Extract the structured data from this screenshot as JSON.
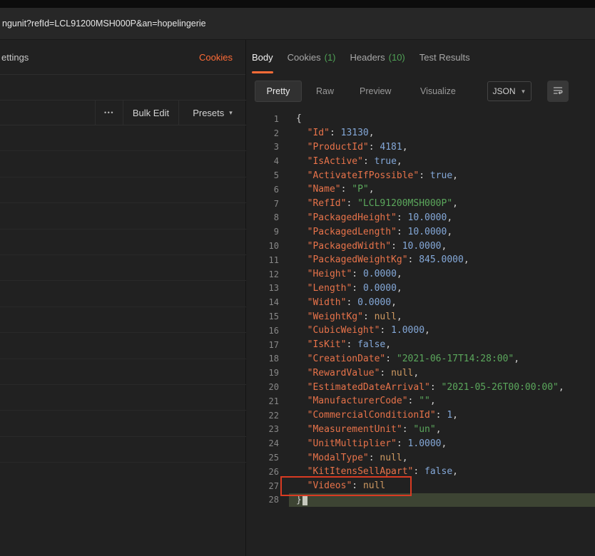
{
  "topbar": {
    "url": "ngunit?refId=LCL91200MSH000P&an=hopelingerie"
  },
  "request_panel": {
    "settings_tab": "ettings",
    "cookies_link": "Cookies",
    "more_button": "•••",
    "bulk_edit": "Bulk Edit",
    "presets": "Presets",
    "row_count": 13
  },
  "response": {
    "tabs": [
      {
        "label": "Body",
        "active": true
      },
      {
        "label": "Cookies",
        "count": "(1)"
      },
      {
        "label": "Headers",
        "count": "(10)"
      },
      {
        "label": "Test Results"
      }
    ],
    "view_modes": [
      "Pretty",
      "Raw",
      "Preview",
      "Visualize"
    ],
    "active_mode": "Pretty",
    "format": "JSON",
    "code_lines": [
      {
        "n": 1,
        "t": [
          [
            "pt",
            "{"
          ]
        ]
      },
      {
        "n": 2,
        "t": [
          [
            "pt",
            "  "
          ],
          [
            "key",
            "\"Id\""
          ],
          [
            "pt",
            ": "
          ],
          [
            "num",
            "13130"
          ],
          [
            "pt",
            ","
          ]
        ]
      },
      {
        "n": 3,
        "t": [
          [
            "pt",
            "  "
          ],
          [
            "key",
            "\"ProductId\""
          ],
          [
            "pt",
            ": "
          ],
          [
            "num",
            "4181"
          ],
          [
            "pt",
            ","
          ]
        ]
      },
      {
        "n": 4,
        "t": [
          [
            "pt",
            "  "
          ],
          [
            "key",
            "\"IsActive\""
          ],
          [
            "pt",
            ": "
          ],
          [
            "bool",
            "true"
          ],
          [
            "pt",
            ","
          ]
        ]
      },
      {
        "n": 5,
        "t": [
          [
            "pt",
            "  "
          ],
          [
            "key",
            "\"ActivateIfPossible\""
          ],
          [
            "pt",
            ": "
          ],
          [
            "bool",
            "true"
          ],
          [
            "pt",
            ","
          ]
        ]
      },
      {
        "n": 6,
        "t": [
          [
            "pt",
            "  "
          ],
          [
            "key",
            "\"Name\""
          ],
          [
            "pt",
            ": "
          ],
          [
            "str",
            "\"P\""
          ],
          [
            "pt",
            ","
          ]
        ]
      },
      {
        "n": 7,
        "t": [
          [
            "pt",
            "  "
          ],
          [
            "key",
            "\"RefId\""
          ],
          [
            "pt",
            ": "
          ],
          [
            "str",
            "\"LCL91200MSH000P\""
          ],
          [
            "pt",
            ","
          ]
        ]
      },
      {
        "n": 8,
        "t": [
          [
            "pt",
            "  "
          ],
          [
            "key",
            "\"PackagedHeight\""
          ],
          [
            "pt",
            ": "
          ],
          [
            "num",
            "10.0000"
          ],
          [
            "pt",
            ","
          ]
        ]
      },
      {
        "n": 9,
        "t": [
          [
            "pt",
            "  "
          ],
          [
            "key",
            "\"PackagedLength\""
          ],
          [
            "pt",
            ": "
          ],
          [
            "num",
            "10.0000"
          ],
          [
            "pt",
            ","
          ]
        ]
      },
      {
        "n": 10,
        "t": [
          [
            "pt",
            "  "
          ],
          [
            "key",
            "\"PackagedWidth\""
          ],
          [
            "pt",
            ": "
          ],
          [
            "num",
            "10.0000"
          ],
          [
            "pt",
            ","
          ]
        ]
      },
      {
        "n": 11,
        "t": [
          [
            "pt",
            "  "
          ],
          [
            "key",
            "\"PackagedWeightKg\""
          ],
          [
            "pt",
            ": "
          ],
          [
            "num",
            "845.0000"
          ],
          [
            "pt",
            ","
          ]
        ]
      },
      {
        "n": 12,
        "t": [
          [
            "pt",
            "  "
          ],
          [
            "key",
            "\"Height\""
          ],
          [
            "pt",
            ": "
          ],
          [
            "num",
            "0.0000"
          ],
          [
            "pt",
            ","
          ]
        ]
      },
      {
        "n": 13,
        "t": [
          [
            "pt",
            "  "
          ],
          [
            "key",
            "\"Length\""
          ],
          [
            "pt",
            ": "
          ],
          [
            "num",
            "0.0000"
          ],
          [
            "pt",
            ","
          ]
        ]
      },
      {
        "n": 14,
        "t": [
          [
            "pt",
            "  "
          ],
          [
            "key",
            "\"Width\""
          ],
          [
            "pt",
            ": "
          ],
          [
            "num",
            "0.0000"
          ],
          [
            "pt",
            ","
          ]
        ]
      },
      {
        "n": 15,
        "t": [
          [
            "pt",
            "  "
          ],
          [
            "key",
            "\"WeightKg\""
          ],
          [
            "pt",
            ": "
          ],
          [
            "nul",
            "null"
          ],
          [
            "pt",
            ","
          ]
        ]
      },
      {
        "n": 16,
        "t": [
          [
            "pt",
            "  "
          ],
          [
            "key",
            "\"CubicWeight\""
          ],
          [
            "pt",
            ": "
          ],
          [
            "num",
            "1.0000"
          ],
          [
            "pt",
            ","
          ]
        ]
      },
      {
        "n": 17,
        "t": [
          [
            "pt",
            "  "
          ],
          [
            "key",
            "\"IsKit\""
          ],
          [
            "pt",
            ": "
          ],
          [
            "bool",
            "false"
          ],
          [
            "pt",
            ","
          ]
        ]
      },
      {
        "n": 18,
        "t": [
          [
            "pt",
            "  "
          ],
          [
            "key",
            "\"CreationDate\""
          ],
          [
            "pt",
            ": "
          ],
          [
            "str",
            "\"2021-06-17T14:28:00\""
          ],
          [
            "pt",
            ","
          ]
        ]
      },
      {
        "n": 19,
        "t": [
          [
            "pt",
            "  "
          ],
          [
            "key",
            "\"RewardValue\""
          ],
          [
            "pt",
            ": "
          ],
          [
            "nul",
            "null"
          ],
          [
            "pt",
            ","
          ]
        ]
      },
      {
        "n": 20,
        "t": [
          [
            "pt",
            "  "
          ],
          [
            "key",
            "\"EstimatedDateArrival\""
          ],
          [
            "pt",
            ": "
          ],
          [
            "str",
            "\"2021-05-26T00:00:00\""
          ],
          [
            "pt",
            ","
          ]
        ]
      },
      {
        "n": 21,
        "t": [
          [
            "pt",
            "  "
          ],
          [
            "key",
            "\"ManufacturerCode\""
          ],
          [
            "pt",
            ": "
          ],
          [
            "str",
            "\"\""
          ],
          [
            "pt",
            ","
          ]
        ]
      },
      {
        "n": 22,
        "t": [
          [
            "pt",
            "  "
          ],
          [
            "key",
            "\"CommercialConditionId\""
          ],
          [
            "pt",
            ": "
          ],
          [
            "num",
            "1"
          ],
          [
            "pt",
            ","
          ]
        ]
      },
      {
        "n": 23,
        "t": [
          [
            "pt",
            "  "
          ],
          [
            "key",
            "\"MeasurementUnit\""
          ],
          [
            "pt",
            ": "
          ],
          [
            "str",
            "\"un\""
          ],
          [
            "pt",
            ","
          ]
        ]
      },
      {
        "n": 24,
        "t": [
          [
            "pt",
            "  "
          ],
          [
            "key",
            "\"UnitMultiplier\""
          ],
          [
            "pt",
            ": "
          ],
          [
            "num",
            "1.0000"
          ],
          [
            "pt",
            ","
          ]
        ]
      },
      {
        "n": 25,
        "t": [
          [
            "pt",
            "  "
          ],
          [
            "key",
            "\"ModalType\""
          ],
          [
            "pt",
            ": "
          ],
          [
            "nul",
            "null"
          ],
          [
            "pt",
            ","
          ]
        ]
      },
      {
        "n": 26,
        "t": [
          [
            "pt",
            "  "
          ],
          [
            "key",
            "\"KitItensSellApart\""
          ],
          [
            "pt",
            ": "
          ],
          [
            "bool",
            "false"
          ],
          [
            "pt",
            ","
          ]
        ]
      },
      {
        "n": 27,
        "t": [
          [
            "pt",
            "  "
          ],
          [
            "key",
            "\"Videos\""
          ],
          [
            "pt",
            ": "
          ],
          [
            "nul",
            "null"
          ]
        ]
      },
      {
        "n": 28,
        "t": [
          [
            "pt",
            "}"
          ]
        ],
        "highlight": true,
        "cursor": true
      }
    ]
  },
  "colors": {
    "accent_orange": "#ff6c37",
    "count_green": "#4fa155",
    "annotation_red": "#d93b22",
    "json_key": "#e8734a",
    "json_string": "#5ba75c",
    "json_number": "#84a8d8",
    "json_bool": "#84a8d8",
    "json_null": "#cf9a62",
    "cursor_line": "#3d4433"
  }
}
